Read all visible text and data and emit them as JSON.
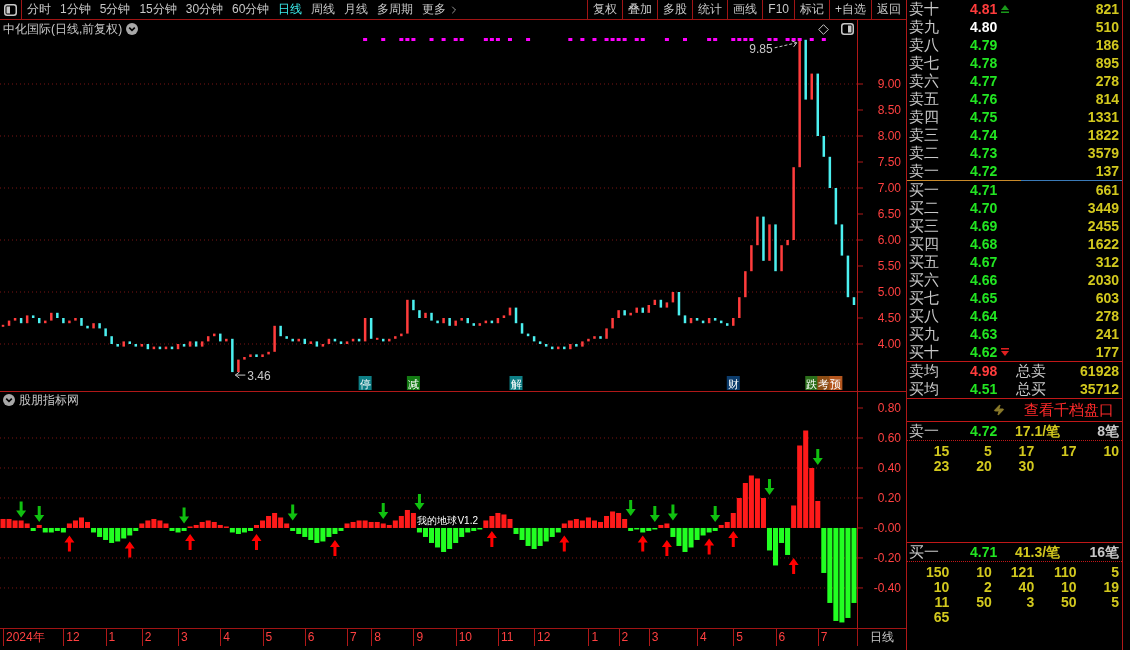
{
  "toolbar": {
    "periods": [
      {
        "label": "分时",
        "selected": false
      },
      {
        "label": "1分钟",
        "selected": false
      },
      {
        "label": "5分钟",
        "selected": false
      },
      {
        "label": "15分钟",
        "selected": false
      },
      {
        "label": "30分钟",
        "selected": false
      },
      {
        "label": "60分钟",
        "selected": false
      },
      {
        "label": "日线",
        "selected": true
      },
      {
        "label": "周线",
        "selected": false
      },
      {
        "label": "月线",
        "selected": false
      },
      {
        "label": "多周期",
        "selected": false
      }
    ],
    "more": "更多",
    "actions": [
      "复权",
      "叠加",
      "多股",
      "统计",
      "画线",
      "F10",
      "标记",
      "+自选",
      "返回"
    ]
  },
  "main_chart": {
    "title": "中化国际(日线,前复权)",
    "price_axis": [
      "9.00",
      "8.50",
      "8.00",
      "7.50",
      "7.00",
      "6.50",
      "6.00",
      "5.50",
      "5.00",
      "4.50",
      "4.00"
    ],
    "high_label": "9.85",
    "low_label": "3.46",
    "events": [
      {
        "label": "停",
        "color": "#0e7f86"
      },
      {
        "label": "减",
        "color": "#137a13"
      },
      {
        "label": "解",
        "color": "#0e7f86"
      },
      {
        "label": "财",
        "color": "#0c3c6c"
      },
      {
        "label": "跌",
        "color": "#2b6e1a"
      },
      {
        "label": "考",
        "color": "#8c4c14"
      },
      {
        "label": "预",
        "color": "#b4561e"
      }
    ]
  },
  "indicator": {
    "title": "股朋指标网",
    "chart_data": {
      "type": "bar",
      "ylim": [
        -0.667,
        0.8
      ],
      "grid": true,
      "yticks": [
        {
          "value": 0.8,
          "label": "0.80"
        },
        {
          "value": 0.6,
          "label": "0.60"
        },
        {
          "value": 0.4,
          "label": "0.40"
        },
        {
          "value": 0.2,
          "label": "0.20"
        },
        {
          "value": 0,
          "label": "-0.00"
        },
        {
          "value": -0.2,
          "label": "-0.20"
        },
        {
          "value": -0.4,
          "label": "-0.40"
        }
      ],
      "values": [
        0.06,
        0.06,
        0.05,
        0.05,
        0.03,
        -0.02,
        0.02,
        -0.03,
        -0.03,
        -0.02,
        -0.03,
        0.03,
        0.05,
        0.07,
        0.04,
        -0.03,
        -0.06,
        -0.08,
        -0.1,
        -0.09,
        -0.07,
        -0.05,
        -0.02,
        0.03,
        0.05,
        0.06,
        0.05,
        0.03,
        -0.02,
        -0.03,
        -0.02,
        0.01,
        0.02,
        0.04,
        0.05,
        0.04,
        0.02,
        0.01,
        -0.03,
        -0.04,
        -0.03,
        -0.02,
        0.02,
        0.05,
        0.08,
        0.1,
        0.07,
        0.03,
        -0.02,
        -0.04,
        -0.06,
        -0.08,
        -0.1,
        -0.09,
        -0.06,
        -0.04,
        -0.02,
        0.03,
        0.04,
        0.05,
        0.05,
        0.04,
        0.04,
        0.03,
        0.02,
        0.05,
        0.08,
        0.12,
        0.1,
        -0.03,
        -0.06,
        -0.1,
        -0.13,
        -0.16,
        -0.14,
        -0.1,
        -0.06,
        -0.03,
        -0.02,
        -0.01,
        0.05,
        0.08,
        0.1,
        0.09,
        0.06,
        -0.04,
        -0.08,
        -0.12,
        -0.14,
        -0.12,
        -0.09,
        -0.06,
        -0.03,
        0.03,
        0.05,
        0.06,
        0.05,
        0.07,
        0.05,
        0.04,
        0.08,
        0.11,
        0.1,
        0.06,
        -0.02,
        -0.01,
        -0.03,
        -0.02,
        -0.01,
        0.02,
        0.03,
        -0.06,
        -0.12,
        -0.16,
        -0.13,
        -0.08,
        -0.05,
        -0.03,
        -0.02,
        0.02,
        0.04,
        0.1,
        0.2,
        0.3,
        0.35,
        0.33,
        0.2,
        -0.15,
        -0.25,
        -0.1,
        -0.18,
        0.15,
        0.55,
        0.65,
        0.4,
        0.18,
        -0.3,
        -0.5,
        -0.62,
        -0.63,
        -0.6,
        -0.5
      ]
    },
    "overlay_label": "我的地球V1.2"
  },
  "date_axis": {
    "labels": [
      "2024年",
      "12",
      "1",
      "2",
      "3",
      "4",
      "5",
      "6",
      "7",
      "8",
      "9",
      "10",
      "11",
      "12",
      "1",
      "2",
      "3",
      "4",
      "5",
      "6",
      "7"
    ],
    "period": "日线"
  },
  "order_book": {
    "asks": [
      {
        "label": "卖十",
        "price": "4.81",
        "color": "#ff3c3c",
        "volume": "821",
        "marked": true
      },
      {
        "label": "卖九",
        "price": "4.80",
        "color": "#ffffff",
        "volume": "510",
        "marked": false
      },
      {
        "label": "卖八",
        "price": "4.79",
        "color": "#22e622",
        "volume": "186",
        "marked": false
      },
      {
        "label": "卖七",
        "price": "4.78",
        "color": "#22e622",
        "volume": "895",
        "marked": false
      },
      {
        "label": "卖六",
        "price": "4.77",
        "color": "#22e622",
        "volume": "278",
        "marked": false
      },
      {
        "label": "卖五",
        "price": "4.76",
        "color": "#22e622",
        "volume": "814",
        "marked": false
      },
      {
        "label": "卖四",
        "price": "4.75",
        "color": "#22e622",
        "volume": "1331",
        "marked": false
      },
      {
        "label": "卖三",
        "price": "4.74",
        "color": "#22e622",
        "volume": "1822",
        "marked": false
      },
      {
        "label": "卖二",
        "price": "4.73",
        "color": "#22e622",
        "volume": "3579",
        "marked": false
      },
      {
        "label": "卖一",
        "price": "4.72",
        "color": "#22e622",
        "volume": "137",
        "marked": false
      }
    ],
    "bids": [
      {
        "label": "买一",
        "price": "4.71",
        "color": "#22e622",
        "volume": "661",
        "marked": false
      },
      {
        "label": "买二",
        "price": "4.70",
        "color": "#22e622",
        "volume": "3449",
        "marked": false
      },
      {
        "label": "买三",
        "price": "4.69",
        "color": "#22e622",
        "volume": "2455",
        "marked": false
      },
      {
        "label": "买四",
        "price": "4.68",
        "color": "#22e622",
        "volume": "1622",
        "marked": false
      },
      {
        "label": "买五",
        "price": "4.67",
        "color": "#22e622",
        "volume": "312",
        "marked": false
      },
      {
        "label": "买六",
        "price": "4.66",
        "color": "#22e622",
        "volume": "2030",
        "marked": false
      },
      {
        "label": "买七",
        "price": "4.65",
        "color": "#22e622",
        "volume": "603",
        "marked": false
      },
      {
        "label": "买八",
        "price": "4.64",
        "color": "#22e622",
        "volume": "278",
        "marked": false
      },
      {
        "label": "买九",
        "price": "4.63",
        "color": "#22e622",
        "volume": "241",
        "marked": false
      },
      {
        "label": "买十",
        "price": "4.62",
        "color": "#22e622",
        "volume": "177",
        "marked": true
      }
    ],
    "summary": [
      {
        "label": "卖均",
        "price": "4.98",
        "color": "#ff3c3c",
        "total_label": "总卖",
        "total": "61928"
      },
      {
        "label": "买均",
        "price": "4.51",
        "color": "#22e622",
        "total_label": "总买",
        "total": "35712"
      }
    ]
  },
  "depth_button": "查看千档盘口",
  "queues": [
    {
      "label": "卖一",
      "price": "4.72",
      "color": "#22e622",
      "average": "17.1/笔",
      "count": "8笔",
      "orders": [
        "15",
        "5",
        "17",
        "17",
        "10",
        "23",
        "20",
        "30"
      ]
    },
    {
      "label": "买一",
      "price": "4.71",
      "color": "#22e622",
      "average": "41.3/笔",
      "count": "16笔",
      "orders": [
        "150",
        "10",
        "121",
        "110",
        "5",
        "10",
        "2",
        "40",
        "10",
        "19",
        "11",
        "50",
        "3",
        "50",
        "5",
        "65"
      ]
    }
  ]
}
